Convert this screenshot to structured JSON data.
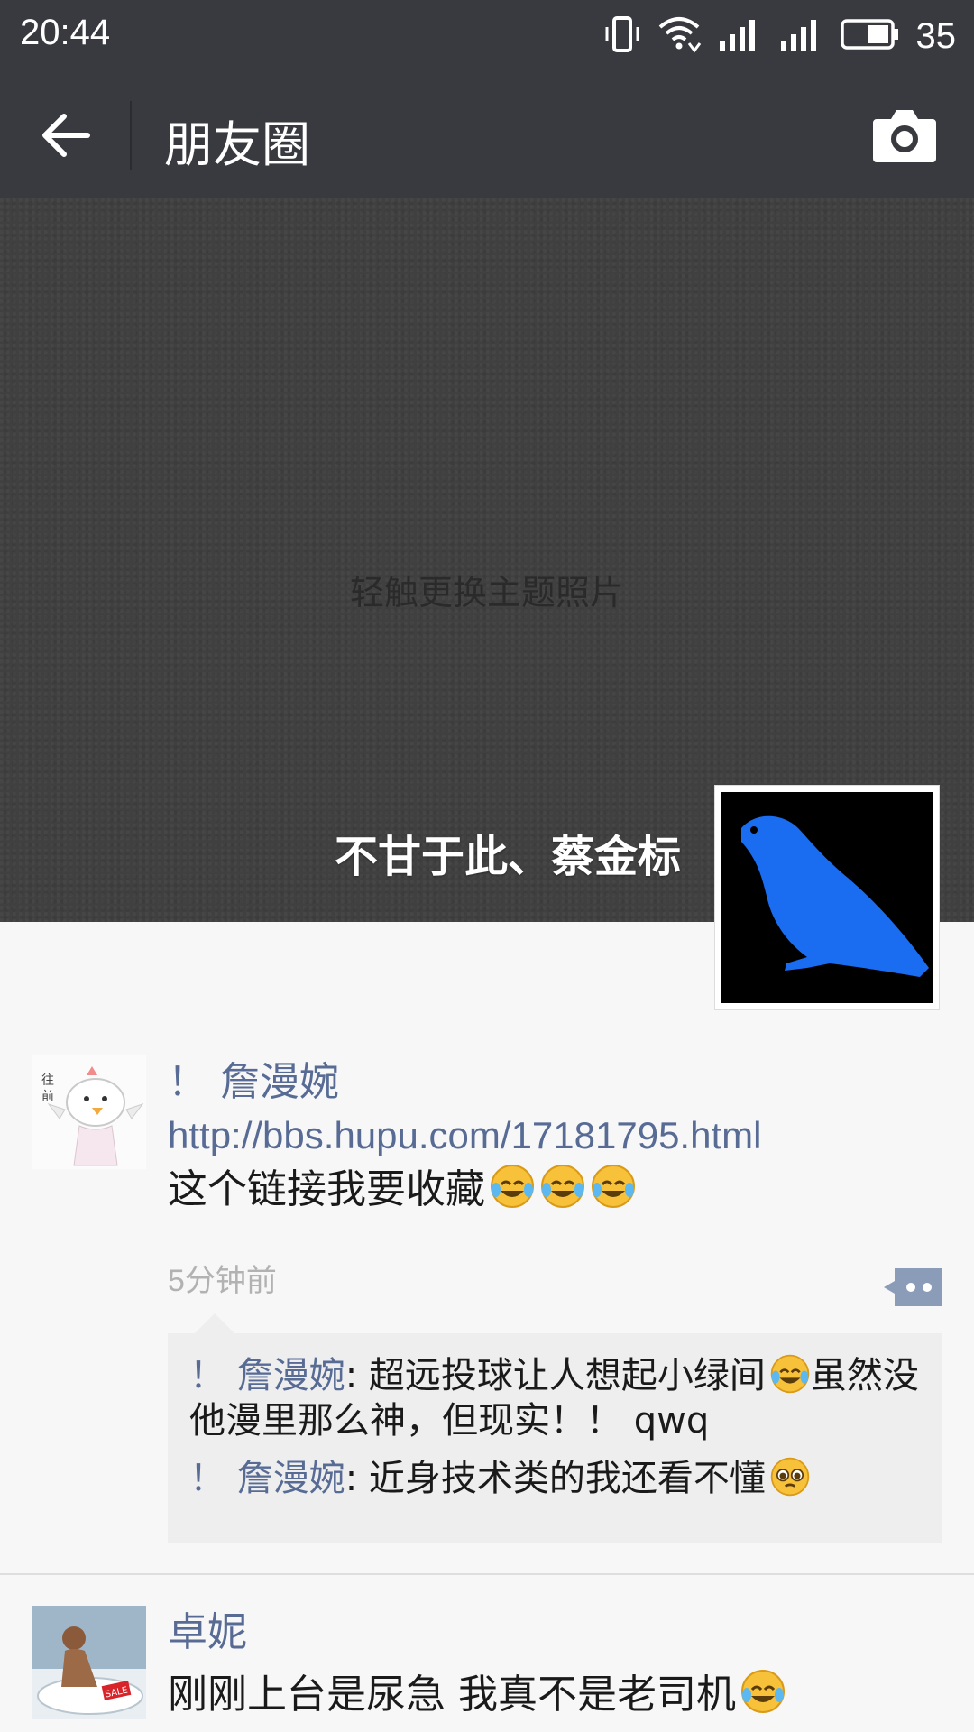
{
  "status_bar": {
    "time": "20:44",
    "battery_level": "35",
    "icons": [
      "vibrate-icon",
      "wifi-icon",
      "signal-icon",
      "signal-icon",
      "battery-icon"
    ]
  },
  "nav": {
    "title": "朋友圈",
    "back_icon": "back-arrow-icon",
    "camera_icon": "camera-icon"
  },
  "cover": {
    "hint": "轻触更换主题照片",
    "profile_name": "不甘于此、蔡金标"
  },
  "posts": [
    {
      "name": "！ 詹漫婉",
      "link": "http://bbs.hupu.com/17181795.html",
      "text": "这个链接我要收藏",
      "emojis": [
        "laughing-crying-emoji",
        "laughing-crying-emoji",
        "laughing-crying-emoji"
      ],
      "time": "5分钟前",
      "comments": [
        {
          "name": "！ 詹漫婉",
          "text_before": "超远投球让人想起小绿间",
          "emoji": "laughing-crying-emoji",
          "text_after": "虽然没他漫里那么神，但现实！！ qwq"
        },
        {
          "name": "！ 詹漫婉",
          "text_before": "近身技术类的我还看不懂",
          "emoji": "pleading-emoji",
          "text_after": ""
        }
      ]
    },
    {
      "name": "卓妮",
      "text": "刚刚上台是尿急 我真不是老司机",
      "emoji": "laughing-crying-emoji",
      "avatar_badge": "SALE"
    }
  ]
}
